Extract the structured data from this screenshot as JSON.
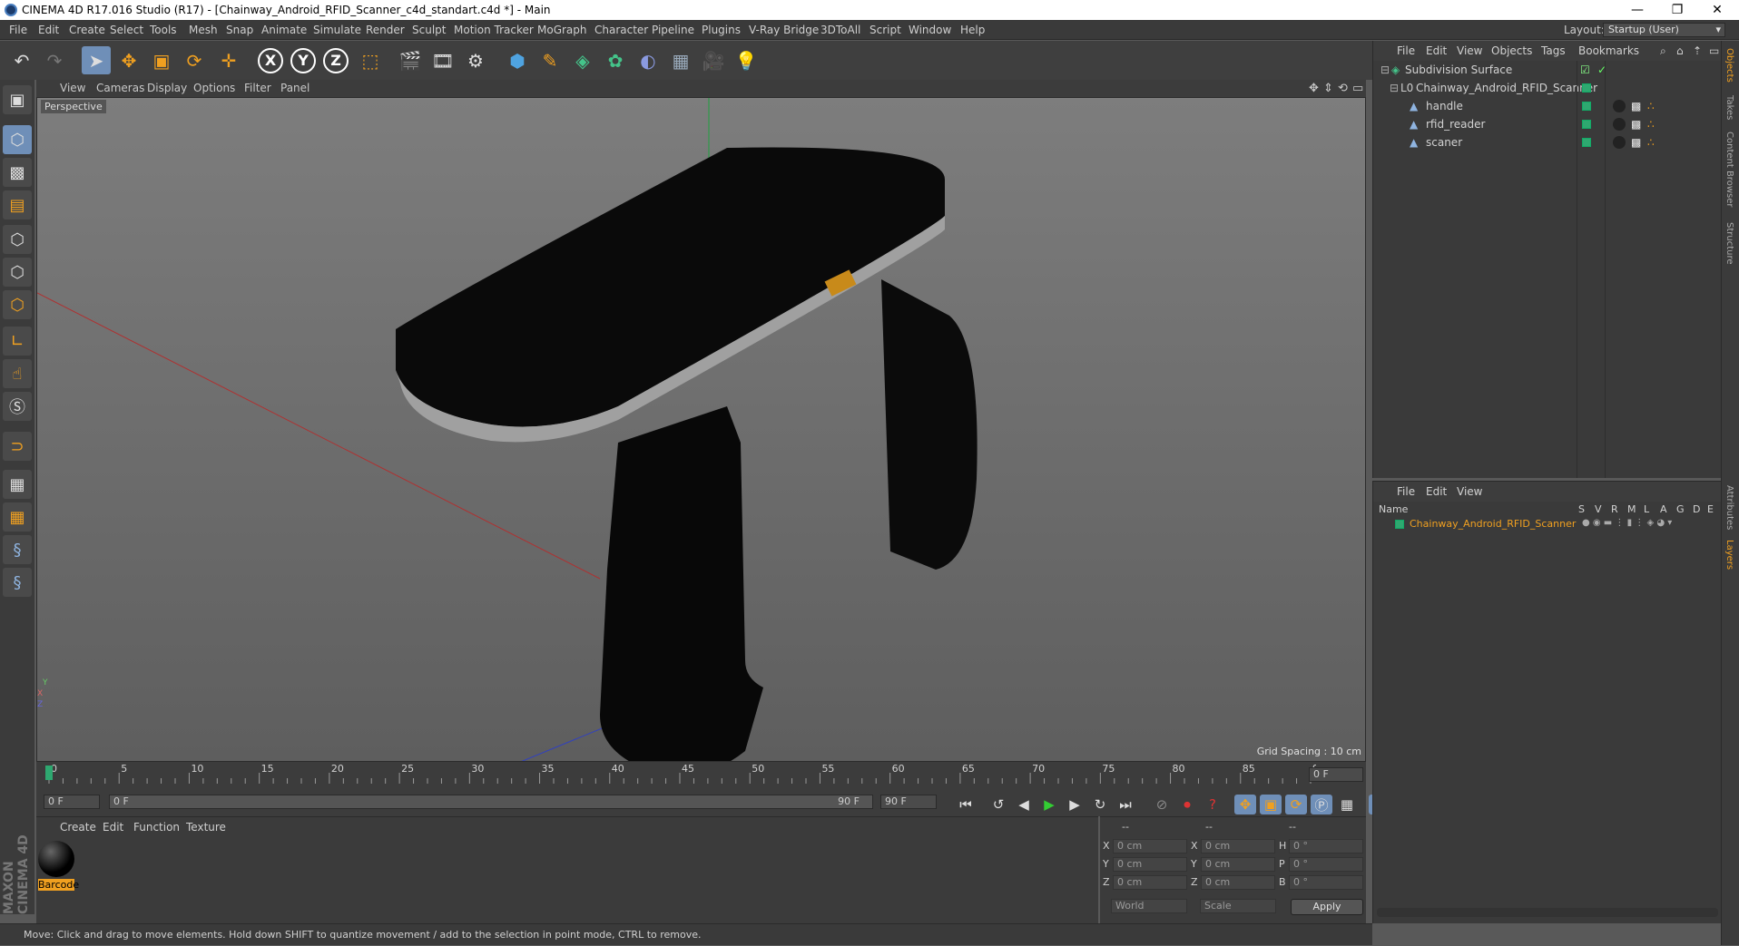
{
  "window": {
    "title": "CINEMA 4D R17.016 Studio (R17) - [Chainway_Android_RFID_Scanner_c4d_standart.c4d *] - Main",
    "minimize": "—",
    "maximize": "❐",
    "close": "✕"
  },
  "menubar": {
    "items": [
      "File",
      "Edit",
      "Create",
      "Select",
      "Tools",
      "Mesh",
      "Snap",
      "Animate",
      "Simulate",
      "Render",
      "Sculpt",
      "Motion Tracker",
      "MoGraph",
      "Character",
      "Pipeline",
      "Plugins",
      "V-Ray Bridge",
      "3DToAll",
      "Script",
      "Window",
      "Help"
    ],
    "layout_label": "Layout:",
    "layout_value": "Startup (User)"
  },
  "toolbar": {
    "icons": [
      "undo-icon",
      "redo-icon",
      "live-selection-icon",
      "move-icon",
      "scale-icon",
      "rotate-icon",
      "recent-tool-icon",
      "x-axis-icon",
      "y-axis-icon",
      "z-axis-icon",
      "world-coordinates-icon",
      "render-view-icon",
      "render-picture-viewer-icon",
      "render-settings-icon",
      "cube-icon",
      "pen-icon",
      "subdivision-icon",
      "cloner-icon",
      "deformer-icon",
      "floor-icon",
      "camera-icon",
      "light-icon"
    ],
    "x": "X",
    "y": "Y",
    "z": "Z"
  },
  "viewport": {
    "menu": [
      "View",
      "Cameras",
      "Display",
      "Options",
      "Filter",
      "Panel"
    ],
    "camera_label": "Perspective",
    "grid_spacing": "Grid Spacing : 10 cm",
    "axis_x": "X",
    "axis_y": "Y",
    "axis_z": "Z"
  },
  "timeline": {
    "ticks": [
      "0",
      "5",
      "10",
      "15",
      "20",
      "25",
      "30",
      "35",
      "40",
      "45",
      "50",
      "55",
      "60",
      "65",
      "70",
      "75",
      "80",
      "85",
      "90"
    ],
    "end_frame": "0 F",
    "current_frame": "0 F",
    "range_start": "0 F",
    "range_end": "90 F",
    "max_frame": "90 F"
  },
  "materials": {
    "menu": [
      "Create",
      "Edit",
      "Function",
      "Texture"
    ],
    "items": [
      {
        "name": "Barcode"
      }
    ]
  },
  "coordinates": {
    "header": [
      "--",
      "--",
      "--"
    ],
    "rows": [
      {
        "l1": "X",
        "v1": "0 cm",
        "l2": "X",
        "v2": "0 cm",
        "l3": "H",
        "v3": "0 °"
      },
      {
        "l1": "Y",
        "v1": "0 cm",
        "l2": "Y",
        "v2": "0 cm",
        "l3": "P",
        "v3": "0 °"
      },
      {
        "l1": "Z",
        "v1": "0 cm",
        "l2": "Z",
        "v2": "0 cm",
        "l3": "B",
        "v3": "0 °"
      }
    ],
    "mode": "World",
    "transform": "Scale",
    "apply": "Apply"
  },
  "objects": {
    "menu": [
      "File",
      "Edit",
      "View",
      "Objects",
      "Tags",
      "Bookmarks"
    ],
    "tree": [
      {
        "name": "Subdivision Surface",
        "indent": 0
      },
      {
        "name": "Chainway_Android_RFID_Scanner",
        "indent": 1
      },
      {
        "name": "handle",
        "indent": 2
      },
      {
        "name": "rfid_reader",
        "indent": 2
      },
      {
        "name": "scaner",
        "indent": 2
      }
    ]
  },
  "layers": {
    "menu": [
      "File",
      "Edit",
      "View"
    ],
    "name_header": "Name",
    "columns": [
      "S",
      "V",
      "R",
      "M",
      "L",
      "A",
      "G",
      "D",
      "E"
    ],
    "items": [
      {
        "name": "Chainway_Android_RFID_Scanner",
        "color": "#2ea870"
      }
    ]
  },
  "side_tabs": [
    "Objects",
    "Takes",
    "Content Browser",
    "Structure",
    "Attributes",
    "Layers"
  ],
  "status": "Move: Click and drag to move elements. Hold down SHIFT to quantize movement / add to the selection in point mode, CTRL to remove.",
  "brand": "MAXON CINEMA 4D",
  "colors": {
    "accent": "#6f8fb8",
    "layer_green": "#2ea870",
    "highlight_orange": "#f0a020"
  }
}
